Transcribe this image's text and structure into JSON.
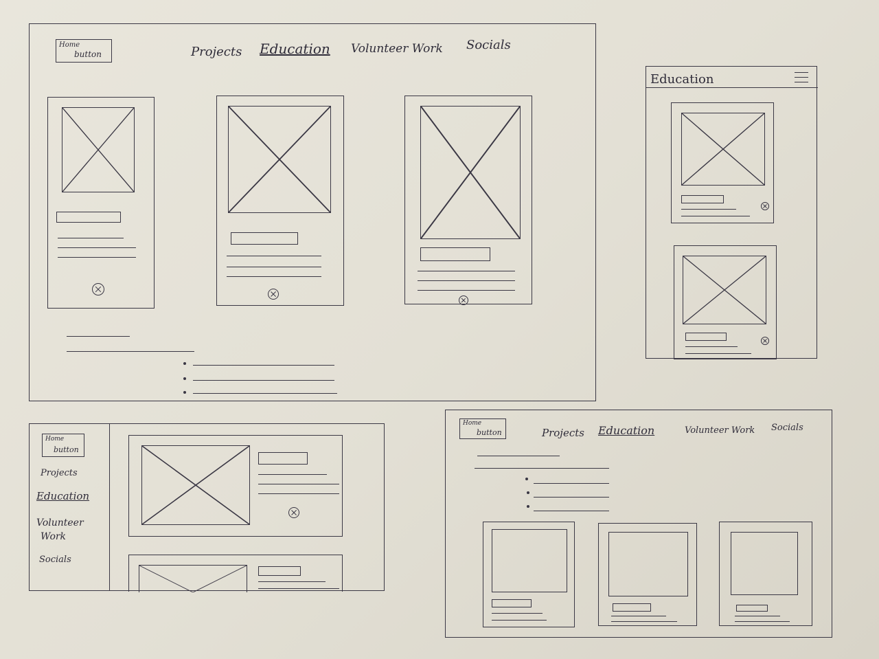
{
  "desktop": {
    "home_line1": "Home",
    "home_line2": "button",
    "nav": [
      "Projects",
      "Education",
      "Volunteer Work",
      "Socials"
    ]
  },
  "mobile": {
    "title": "Education"
  },
  "tablet": {
    "home_line1": "Home",
    "home_line2": "button",
    "nav": [
      "Projects",
      "Education",
      "Volunteer",
      "Work",
      "Socials"
    ]
  },
  "desktop_alt": {
    "home_line1": "Home",
    "home_line2": "button",
    "nav": [
      "Projects",
      "Education",
      "Volunteer Work",
      "Socials"
    ]
  },
  "colors": {
    "paper": "#e6e3d9",
    "ink": "#3a3744"
  }
}
